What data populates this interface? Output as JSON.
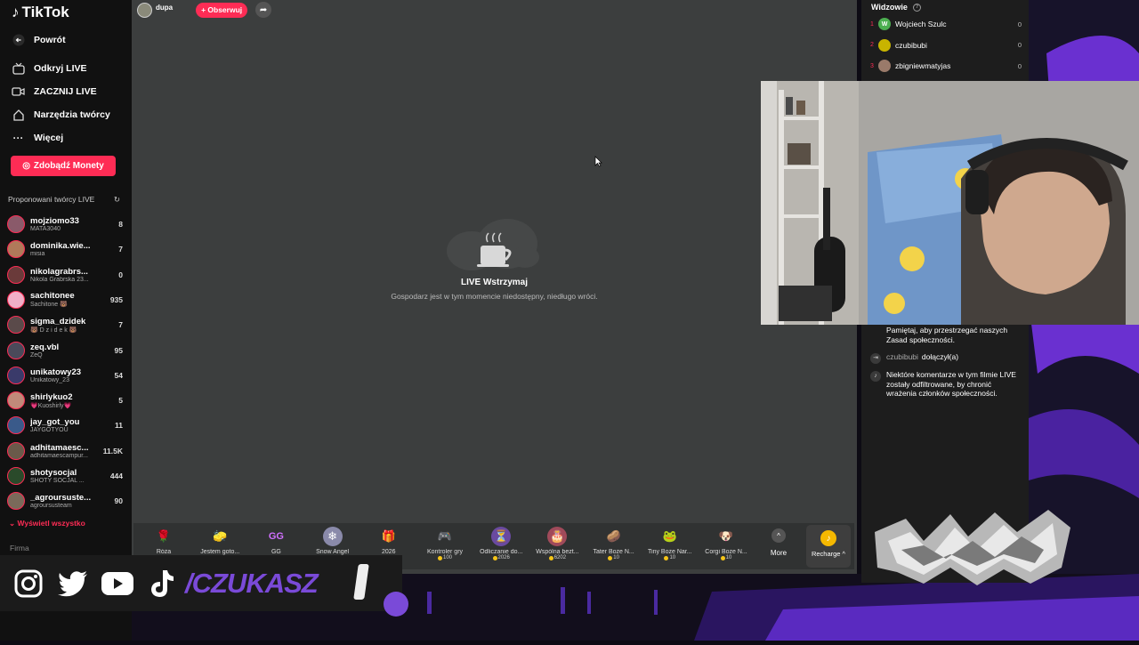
{
  "app": {
    "name": "TikTok"
  },
  "sidebar": {
    "back_label": "Powrót",
    "nav": [
      {
        "label": "Odkryj LIVE",
        "icon": "tv-icon"
      },
      {
        "label": "ZACZNIJ LIVE",
        "icon": "video-camera-icon"
      },
      {
        "label": "Narzędzia twórcy",
        "icon": "house-icon"
      },
      {
        "label": "Więcej",
        "icon": "ellipsis-icon"
      }
    ],
    "coins_button": "Zdobądź Monety",
    "suggested_header": "Proponowani twórcy LIVE",
    "creators": [
      {
        "name": "mojziomo33",
        "sub": "MATA3040",
        "count": "8",
        "color": "#8a5a6a"
      },
      {
        "name": "dominika.wie...",
        "sub": "misia",
        "count": "7",
        "color": "#b07a5a"
      },
      {
        "name": "nikolagrabrs...",
        "sub": "Nikola Grabrska 23...",
        "count": "0",
        "color": "#6a3a3a"
      },
      {
        "name": "sachitonee",
        "sub": "Sachitone 🐻",
        "count": "935",
        "color": "#f0b0c8"
      },
      {
        "name": "sigma_dzidek",
        "sub": "🐻 D z i d e k 🐻",
        "count": "7",
        "color": "#5a4a4a"
      },
      {
        "name": "zeq.vbl",
        "sub": "ZeQ",
        "count": "95",
        "color": "#4a4a5a"
      },
      {
        "name": "unikatowy23",
        "sub": "Unikatowy_23",
        "count": "54",
        "color": "#3a3a6a"
      },
      {
        "name": "shirlykuo2",
        "sub": "💗Kuoshirly💗",
        "count": "5",
        "color": "#c08a7a"
      },
      {
        "name": "jay_got_you",
        "sub": "JAYGOTYOU",
        "count": "11",
        "color": "#3a5a8a"
      },
      {
        "name": "adhitamaesc...",
        "sub": "adhitamaescampur...",
        "count": "11.5K",
        "color": "#6a5a4a"
      },
      {
        "name": "shotysocjal",
        "sub": "SHOTY SOCJAL ...",
        "count": "444",
        "color": "#2a4a2a"
      },
      {
        "name": "_agroursuste...",
        "sub": "agroursusteam",
        "count": "90",
        "color": "#7a6a5a"
      }
    ],
    "show_all": "Wyświetl wszystko",
    "footer_label": "Firma"
  },
  "stream": {
    "host_name": "dupa",
    "follow_label": "+ Obserwuj",
    "pause_title": "LIVE Wstrzymaj",
    "pause_subtitle": "Gospodarz jest w tym momencie niedostępny, niedługo wróci."
  },
  "gifts": [
    {
      "name": "Róża",
      "price": "",
      "icon": "🌹",
      "bg": "transparent"
    },
    {
      "name": "Jestem goto...",
      "price": "",
      "icon": "🧽",
      "bg": "transparent"
    },
    {
      "name": "GG",
      "price": "",
      "icon": "GG",
      "bg": "transparent"
    },
    {
      "name": "Snow Angel",
      "price": "",
      "icon": "❄",
      "bg": "#8a8aaa"
    },
    {
      "name": "2026",
      "price": "",
      "icon": "🎁",
      "bg": "transparent"
    },
    {
      "name": "Kontroler gry",
      "price": "100",
      "icon": "🎮",
      "bg": "transparent"
    },
    {
      "name": "Odliczanie do...",
      "price": "2026",
      "icon": "⏳",
      "bg": "#6a4aa0"
    },
    {
      "name": "Wspólna bezt...",
      "price": "6202",
      "icon": "🎂",
      "bg": "#a04a5a"
    },
    {
      "name": "Tater Boże N...",
      "price": "10",
      "icon": "🥔",
      "bg": "transparent"
    },
    {
      "name": "Tiny Boże Nar...",
      "price": "10",
      "icon": "🐸",
      "bg": "transparent"
    },
    {
      "name": "Corgi Boże N...",
      "price": "10",
      "icon": "🐶",
      "bg": "transparent"
    }
  ],
  "gift_more_label": "More",
  "recharge_label": "Recharge ^",
  "viewers": {
    "title": "Widzowie",
    "list": [
      {
        "rank": "1",
        "name": "Wojciech Szulc",
        "count": "0",
        "initial": "W",
        "color": "#4caf50"
      },
      {
        "rank": "2",
        "name": "czubibubi",
        "count": "0",
        "initial": "",
        "color": "#c8b400"
      },
      {
        "rank": "3",
        "name": "zbigniewmatyjas",
        "count": "0",
        "initial": "",
        "color": "#9a7a6a"
      }
    ]
  },
  "chat": [
    {
      "user": "",
      "text": "Pamiętaj, aby przestrzegać naszych Zasad społeczności.",
      "icon": ""
    },
    {
      "user": "czubibubi",
      "text": "dołączył(a)",
      "icon": "join-icon"
    },
    {
      "user": "",
      "text": "Niektóre komentarze w tym filmie LIVE zostały odfiltrowane, by chronić wrażenia członków społeczności.",
      "icon": "tiktok-icon"
    }
  ],
  "banner": {
    "handle": "/CZUKASZ"
  },
  "colors": {
    "accent": "#fe2c55",
    "purple": "#7a4ad8",
    "coin": "#f5c518"
  }
}
